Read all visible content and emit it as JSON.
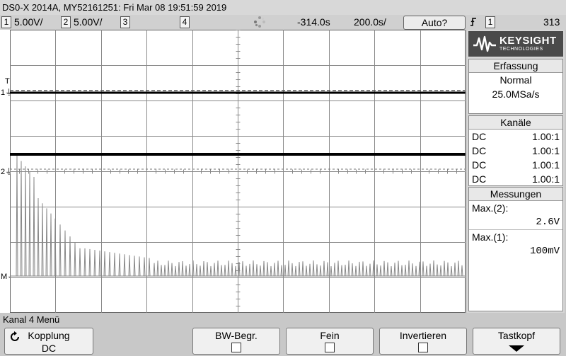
{
  "title_bar": "DS0-X 2014A, MY52161251: Fri Mar 08 19:51:59 2019",
  "channel_bar": {
    "ch1": {
      "num": "1",
      "scale": "5.00V/"
    },
    "ch2": {
      "num": "2",
      "scale": "5.00V/"
    },
    "ch3": {
      "num": "3"
    },
    "ch4": {
      "num": "4"
    },
    "time_delay": "-314.0s",
    "time_scale": "200.0s/",
    "auto_label": "Auto?",
    "trigger_channel": "1",
    "trigger_level": "313"
  },
  "markers": {
    "trigger": "T",
    "ch1": "1",
    "ch2": "2",
    "math": "M"
  },
  "sidebar": {
    "brand": "KEYSIGHT",
    "brand_sub": "TECHNOLOGIES",
    "acquisition": {
      "title": "Erfassung",
      "mode": "Normal",
      "rate": "25.0MSa/s"
    },
    "channels": {
      "title": "Kanäle",
      "rows": [
        {
          "coupling": "DC",
          "probe": "1.00:1"
        },
        {
          "coupling": "DC",
          "probe": "1.00:1"
        },
        {
          "coupling": "DC",
          "probe": "1.00:1"
        },
        {
          "coupling": "DC",
          "probe": "1.00:1"
        }
      ]
    },
    "measurements": {
      "title": "Messungen",
      "items": [
        {
          "label": "Max.(2):",
          "value": "2.6V"
        },
        {
          "label": "Max.(1):",
          "value": "100mV"
        }
      ]
    }
  },
  "footer": {
    "menu_title": "Kanal 4 Menü",
    "softkeys": [
      {
        "label": "Kopplung",
        "value": "DC"
      },
      {
        "label": "BW-Begr."
      },
      {
        "label": "Fein"
      },
      {
        "label": "Invertieren"
      },
      {
        "label": "Tastkopf"
      }
    ]
  },
  "icons": {
    "cycle": "cycle-icon",
    "checkbox": "checkbox-icon",
    "arrow": "down-arrow-icon",
    "trigger_edge": "rising-edge-icon",
    "run": "run-status-icon"
  }
}
